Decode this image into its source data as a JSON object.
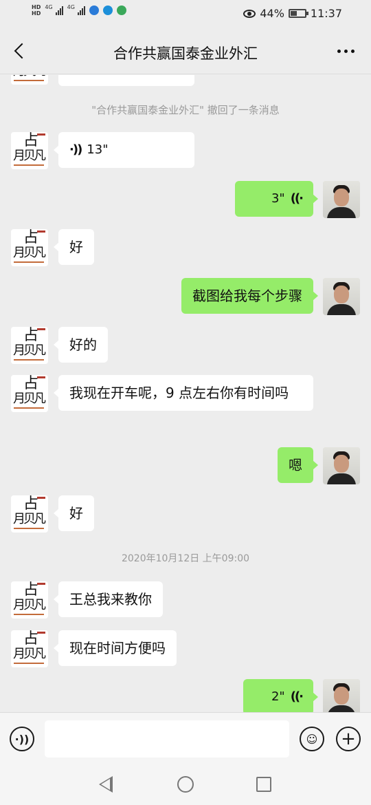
{
  "status_bar": {
    "battery": "44%",
    "battery_level": 0.44,
    "time": "11:37",
    "network_1": "4G",
    "network_2": "4G"
  },
  "header": {
    "title": "合作共赢国泰金业外汇"
  },
  "messages": {
    "recall_notice": "\"合作共赢国泰金业外汇\" 撤回了一条消息",
    "m1_voice_duration": "13\"",
    "m2_voice_duration": "3\"",
    "m3_text": "好",
    "m4_text": "截图给我每个步骤",
    "m5_text": "好的",
    "m6_text": "我现在开车呢，9 点左右你有时间吗",
    "m7_text": "嗯",
    "m8_text": "好",
    "timestamp": "2020年10月12日 上午09:00",
    "m9_text": "王总我来教你",
    "m10_text": "现在时间方便吗",
    "m11_voice_duration": "2\""
  },
  "contact_avatar": {
    "glyph_top": "占",
    "glyph_bottom": "月贝凡"
  },
  "input_bar": {
    "text_value": ""
  },
  "colors": {
    "background": "#ededed",
    "sent_bubble": "#95ec69",
    "received_bubble": "#ffffff"
  },
  "icons": {
    "back": "chevron-left-icon",
    "more": "more-dots-icon",
    "voice_toggle": "voice-icon",
    "emoji": "emoji-icon",
    "plus": "plus-icon"
  }
}
